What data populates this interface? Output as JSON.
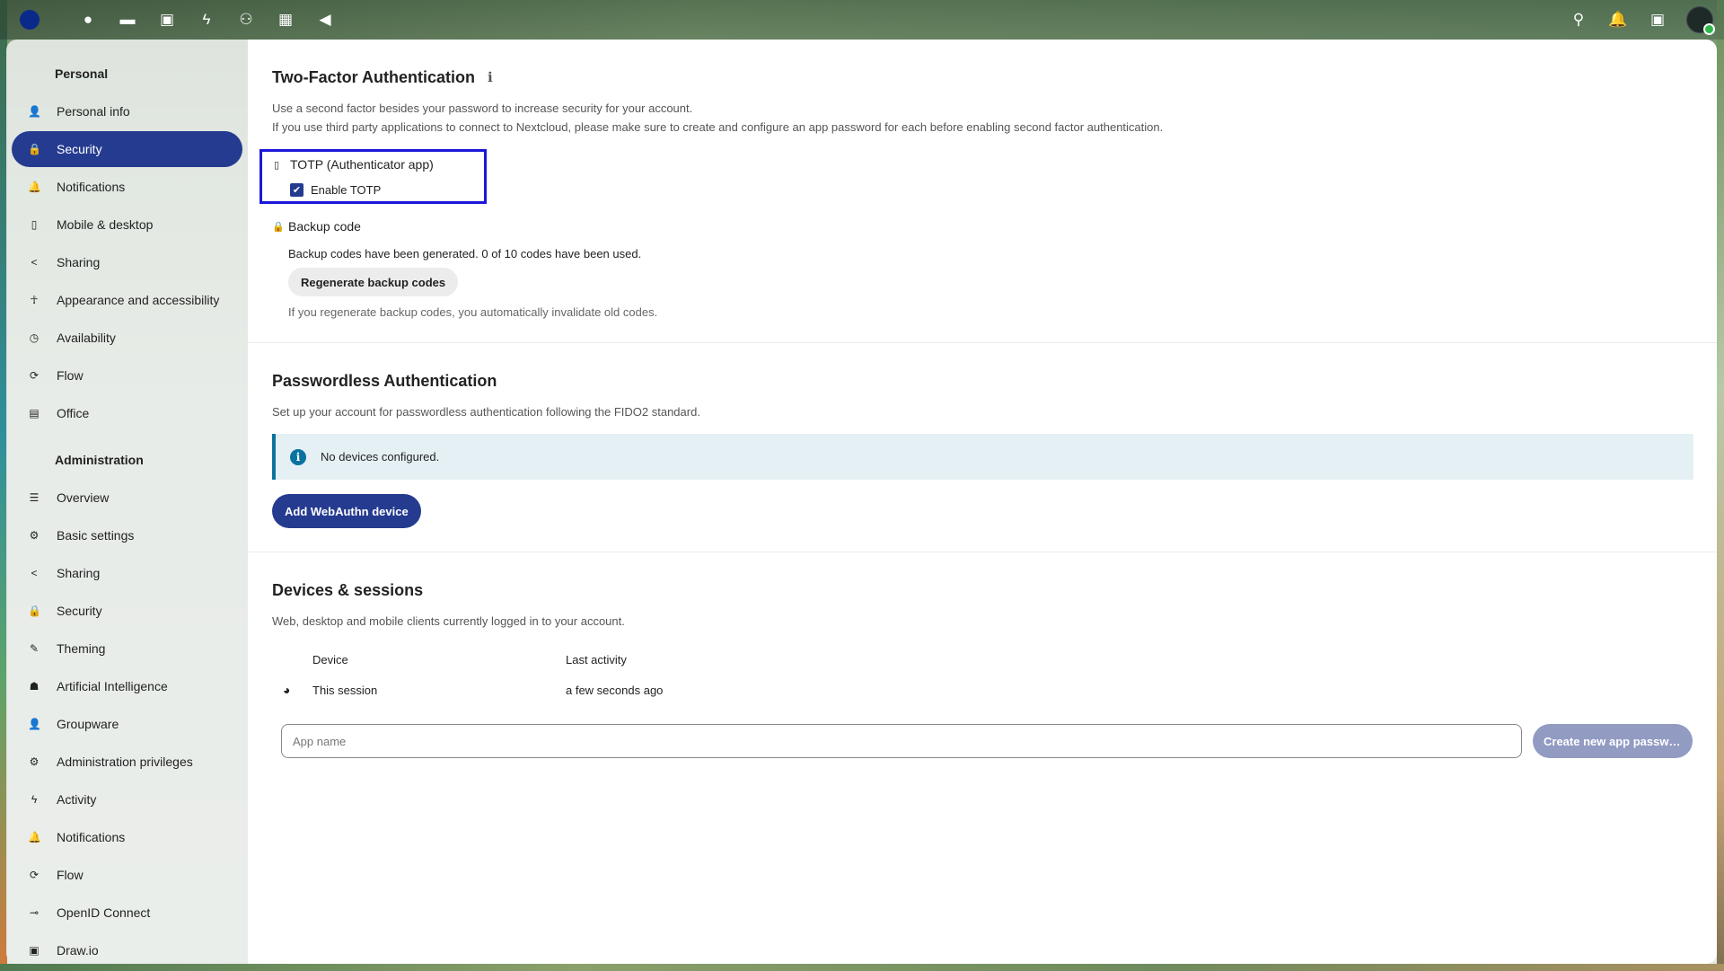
{
  "header": {
    "apps": [
      {
        "icon": "dashboard-icon",
        "glyph": "●"
      },
      {
        "icon": "files-icon",
        "glyph": "▬"
      },
      {
        "icon": "photos-icon",
        "glyph": "▣"
      },
      {
        "icon": "activity-icon",
        "glyph": "ϟ"
      },
      {
        "icon": "contacts-icon",
        "glyph": "⚇"
      },
      {
        "icon": "calendar-icon",
        "glyph": "▦"
      },
      {
        "icon": "announcements-icon",
        "glyph": "◀"
      }
    ],
    "right_icons": [
      {
        "icon": "search-icon",
        "glyph": "⚲"
      },
      {
        "icon": "bell-icon",
        "glyph": "🔔"
      },
      {
        "icon": "contacts-menu-icon",
        "glyph": "▣"
      }
    ]
  },
  "sidebar": {
    "personal_caption": "Personal",
    "personal_items": [
      {
        "label": "Personal info",
        "glyph": "👤",
        "icon": "user-icon"
      },
      {
        "label": "Security",
        "glyph": "🔒",
        "icon": "lock-icon",
        "active": true
      },
      {
        "label": "Notifications",
        "glyph": "🔔",
        "icon": "bell-icon"
      },
      {
        "label": "Mobile & desktop",
        "glyph": "▯",
        "icon": "phone-icon"
      },
      {
        "label": "Sharing",
        "glyph": "<",
        "icon": "share-icon"
      },
      {
        "label": "Appearance and accessibility",
        "glyph": "☥",
        "icon": "accessibility-icon"
      },
      {
        "label": "Availability",
        "glyph": "◷",
        "icon": "clock-icon"
      },
      {
        "label": "Flow",
        "glyph": "⟳",
        "icon": "flow-icon"
      },
      {
        "label": "Office",
        "glyph": "▤",
        "icon": "document-icon"
      }
    ],
    "admin_caption": "Administration",
    "admin_items": [
      {
        "label": "Overview",
        "glyph": "☰",
        "icon": "list-icon"
      },
      {
        "label": "Basic settings",
        "glyph": "⚙",
        "icon": "gear-icon"
      },
      {
        "label": "Sharing",
        "glyph": "<",
        "icon": "share-icon"
      },
      {
        "label": "Security",
        "glyph": "🔒",
        "icon": "lock-icon"
      },
      {
        "label": "Theming",
        "glyph": "✎",
        "icon": "brush-icon"
      },
      {
        "label": "Artificial Intelligence",
        "glyph": "☗",
        "icon": "robot-icon"
      },
      {
        "label": "Groupware",
        "glyph": "👤",
        "icon": "groupware-icon"
      },
      {
        "label": "Administration privileges",
        "glyph": "⚙",
        "icon": "admin-gear-icon"
      },
      {
        "label": "Activity",
        "glyph": "ϟ",
        "icon": "activity-icon"
      },
      {
        "label": "Notifications",
        "glyph": "🔔",
        "icon": "bell-icon"
      },
      {
        "label": "Flow",
        "glyph": "⟳",
        "icon": "flow-icon"
      },
      {
        "label": "OpenID Connect",
        "glyph": "⊸",
        "icon": "openid-icon"
      },
      {
        "label": "Draw.io",
        "glyph": "▣",
        "icon": "drawio-icon"
      }
    ]
  },
  "twofa": {
    "title": "Two-Factor Authentication",
    "desc1": "Use a second factor besides your password to increase security for your account.",
    "desc2": "If you use third party applications to connect to Nextcloud, please make sure to create and configure an app password for each before enabling second factor authentication.",
    "totp_title": "TOTP (Authenticator app)",
    "enable_totp": "Enable TOTP",
    "totp_enabled": true,
    "backup_title": "Backup code",
    "backup_status": "Backup codes have been generated. 0 of 10 codes have been used.",
    "regenerate_label": "Regenerate backup codes",
    "regenerate_hint": "If you regenerate backup codes, you automatically invalidate old codes."
  },
  "passwordless": {
    "title": "Passwordless Authentication",
    "desc": "Set up your account for passwordless authentication following the FIDO2 standard.",
    "notice": "No devices configured.",
    "add_label": "Add WebAuthn device"
  },
  "sessions": {
    "title": "Devices & sessions",
    "desc": "Web, desktop and mobile clients currently logged in to your account.",
    "col_device": "Device",
    "col_activity": "Last activity",
    "rows": [
      {
        "device": "This session",
        "activity": "a few seconds ago",
        "icon": "firefox-icon"
      }
    ],
    "app_name_placeholder": "App name",
    "create_label": "Create new app password"
  },
  "colors": {
    "primary": "#253b90",
    "highlight_border": "#1a17d8",
    "info": "#0b72a0"
  }
}
